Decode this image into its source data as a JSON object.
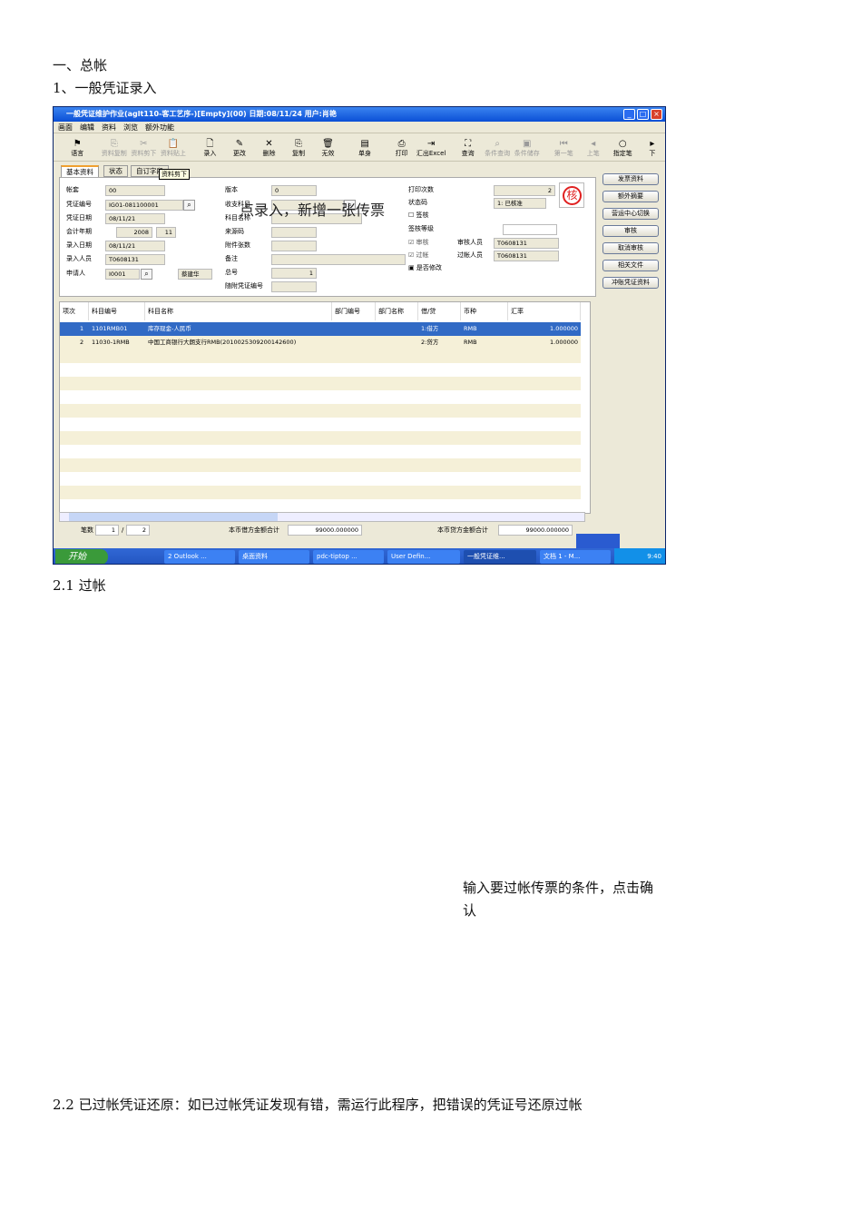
{
  "doc": {
    "h1": "一、总帐",
    "h2": "1、一般凭证录入",
    "h3": "2.1 过帐",
    "note_confirm": "输入要过帐传票的条件，点击确认",
    "h4": "2.2 已过帐凭证还原：如已过帐凭证发现有错，需运行此程序，把错误的凭证号还原过帐"
  },
  "window": {
    "title": "一般凭证维护作业(aglt110-客工艺序-)[Empty](00)   日期:08/11/24   用户:肖艳",
    "menu": [
      "画面",
      "编辑",
      "资料",
      "浏览",
      "额外功能"
    ],
    "toolbar": [
      {
        "label": "语言",
        "icon": "flag-icon",
        "enabled": true
      },
      {
        "label": "资料复制",
        "icon": "copy-icon",
        "enabled": false
      },
      {
        "label": "资料剪下",
        "icon": "cut-icon",
        "enabled": false
      },
      {
        "label": "资料贴上",
        "icon": "paste-icon",
        "enabled": false
      },
      {
        "label": "录入",
        "icon": "new-doc-icon",
        "enabled": true
      },
      {
        "label": "更改",
        "icon": "pencil-icon",
        "enabled": true
      },
      {
        "label": "删除",
        "icon": "x-icon",
        "enabled": true
      },
      {
        "label": "复制",
        "icon": "copy-icon",
        "enabled": true
      },
      {
        "label": "无效",
        "icon": "trash-icon",
        "enabled": true
      },
      {
        "label": "单身",
        "icon": "detail-icon",
        "enabled": true
      },
      {
        "label": "打印",
        "icon": "printer-icon",
        "enabled": true
      },
      {
        "label": "汇出Excel",
        "icon": "export-icon",
        "enabled": true
      },
      {
        "label": "查询",
        "icon": "binoculars-icon",
        "enabled": true
      },
      {
        "label": "条件查询",
        "icon": "query-icon",
        "enabled": false
      },
      {
        "label": "条件储存",
        "icon": "save-icon",
        "enabled": false
      },
      {
        "label": "第一笔",
        "icon": "first-icon",
        "enabled": false
      },
      {
        "label": "上笔",
        "icon": "prev-icon",
        "enabled": false
      },
      {
        "label": "指定笔",
        "icon": "goto-icon",
        "enabled": true
      },
      {
        "label": "下",
        "icon": "next-icon",
        "enabled": true
      }
    ],
    "tabs": [
      "基本资料",
      "状态",
      "自订字段"
    ],
    "tooltip": "资料剪下",
    "overlay_note": "点录入，新增一张传票",
    "form": {
      "ledger_label": "帐套",
      "ledger": "00",
      "voucher_no_label": "凭证编号",
      "voucher_no": "IG01-081100001",
      "voucher_date_label": "凭证日期",
      "voucher_date": "08/11/21",
      "period_label": "会计年期",
      "year": "2008",
      "month": "11",
      "entry_date_label": "录入日期",
      "entry_date": "08/11/21",
      "entry_user_label": "录入人员",
      "entry_user": "T0608131",
      "applicant_label": "申请人",
      "applicant": "I0001",
      "applicant_name": "蔡建华",
      "version_label": "版本",
      "version": "0",
      "pay_subject_label": "收支科目",
      "subject_name_label": "科目名称",
      "source_label": "来源码",
      "attach_label": "附件张数",
      "remark_label": "备注",
      "total_no_label": "总号",
      "total_no": "1",
      "attached_voucher_label": "随附凭证编号",
      "print_count_label": "打印次数",
      "print_count": "2",
      "status_code_label": "状态码",
      "status_code": "1: 已核准",
      "sign_label": "签核",
      "sign_level_label": "签核等级",
      "approved_label": "审核",
      "approver_label": "审核人员",
      "approver": "T0608131",
      "posted_label": "过帐",
      "poster_label": "过帐人员",
      "poster": "T0608131",
      "modify_label": "是否修改",
      "stamp": "核"
    },
    "side_buttons": [
      "发票资料",
      "额外摘要",
      "营运中心切换",
      "审核",
      "取消审核",
      "相关文件",
      "冲账凭证资料"
    ],
    "grid": {
      "headers": [
        "项次",
        "科目编号",
        "科目名称",
        "部门编号",
        "部门名称",
        "借/贷",
        "币种",
        "汇率"
      ],
      "rows": [
        [
          "1",
          "1101RMB01",
          "库存现金-人民币",
          "",
          "",
          "1:借方",
          "RMB",
          "1.000000"
        ],
        [
          "2",
          "11030-1RMB",
          "中国工商银行大朗支行RMB(2010025309200142600)",
          "",
          "",
          "2:贷方",
          "RMB",
          "1.000000"
        ]
      ]
    },
    "footer": {
      "count_label": "笔数",
      "current": "1",
      "total": "2",
      "debit_label": "本币借方金额合计",
      "debit": "99000.000000",
      "credit_label": "本币贷方金额合计",
      "credit": "99000.000000"
    },
    "taskbar": {
      "start": "开始",
      "items": [
        "2 Outlook ...",
        "桌面资料",
        "pdc-tiptop ...",
        "User Defin...",
        "一般凭证维...",
        "文档 1 - M..."
      ],
      "clock": "9:40"
    }
  }
}
